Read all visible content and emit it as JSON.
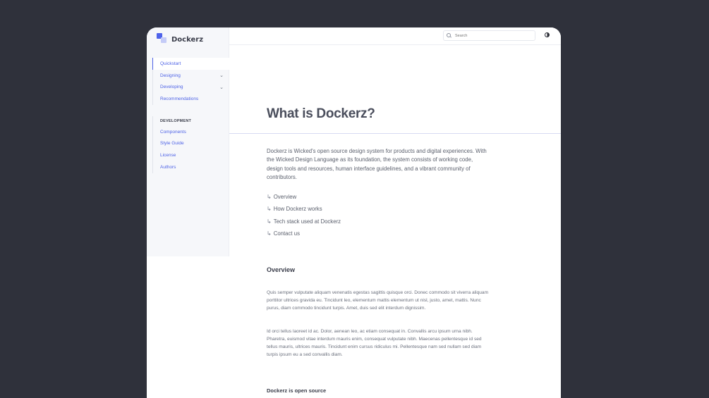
{
  "brand": {
    "name": "Dockerz",
    "icon": "squares-logo-icon"
  },
  "sidebar": {
    "items": [
      {
        "label": "Quickstart",
        "active": true,
        "expandable": false
      },
      {
        "label": "Designing",
        "active": false,
        "expandable": true,
        "chevron": "⌄"
      },
      {
        "label": "Developing",
        "active": false,
        "expandable": true,
        "chevron": "⌄"
      },
      {
        "label": "Recommendations",
        "active": false,
        "expandable": false
      }
    ],
    "section_heading": "DEVELOPMENT",
    "section_items": [
      {
        "label": "Components"
      },
      {
        "label": "Style Guide"
      },
      {
        "label": "License"
      },
      {
        "label": "Authors"
      }
    ]
  },
  "topbar": {
    "search_placeholder": "Search",
    "theme_toggle_icon": "contrast-icon"
  },
  "main": {
    "title": "What is Dockerz?",
    "intro": "Dockerz is Wicked's open source design system for products and digital experiences. With the Wicked Design Language as its foundation, the system consists of working code, design tools and resources, human interface guidelines, and a vibrant community of contributors.",
    "toc": [
      {
        "arrow": "↳",
        "label": "Overview"
      },
      {
        "arrow": "↳",
        "label": "How Dockerz works"
      },
      {
        "arrow": "↳",
        "label": "Tech stack used at Dockerz"
      },
      {
        "arrow": "↳",
        "label": "Contact us"
      }
    ],
    "overview_title": "Overview",
    "overview_p1": "Quis semper vulputate aliquam venenatis egestas sagittis quisque orci. Donec commodo sit viverra aliquam porttitor ultrices gravida eu. Tincidunt leo, elementum mattis elementum ut nisl, justo, amet, mattis. Nunc purus, diam commodo tincidunt turpis. Amet, duis sed elit interdum dignissim.",
    "overview_p2": "Id orci tellus laoreet id ac. Dolor, aenean leo, ac etiam consequat in. Convallis arcu ipsum urna nibh. Pharetra, euismod vitae interdum mauris enim, consequat vulputate nibh. Maecenas pellentesque id sed tellus mauris, ultrices mauris. Tincidunt enim cursus ridiculus mi. Pellentesque nam sed nullam sed diam turpis ipsum eu a sed convallis diam.",
    "open_source_title": "Dockerz is open source"
  },
  "colors": {
    "accent": "#4f63ea",
    "background": "#2f313b",
    "text": "#4a4e5c"
  }
}
